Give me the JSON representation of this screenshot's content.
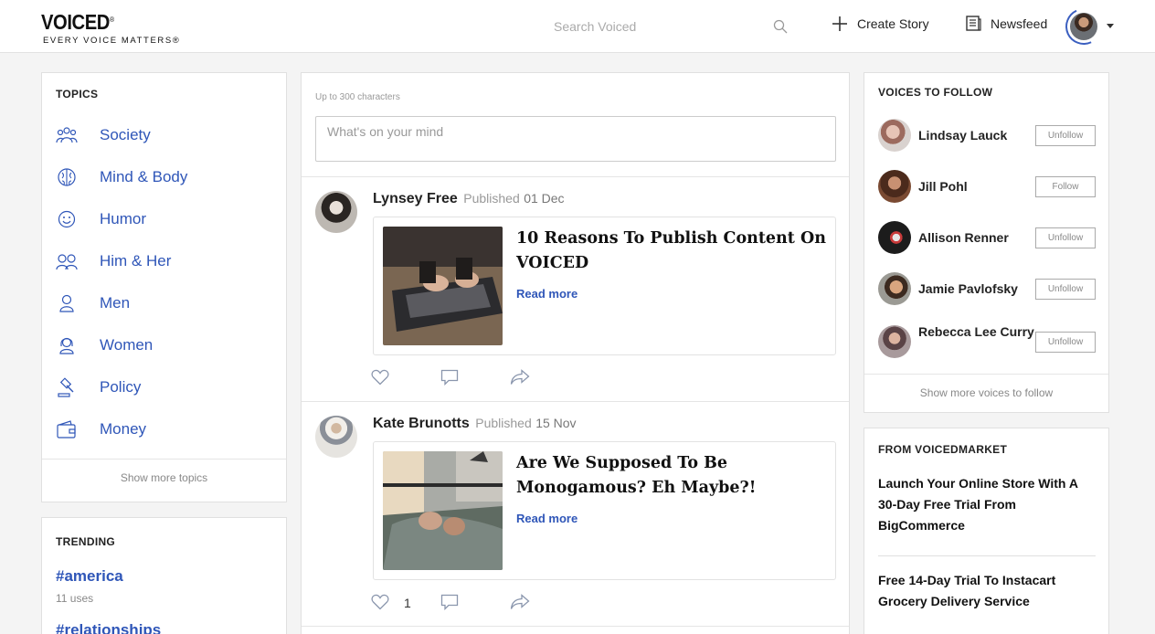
{
  "colors": {
    "accent": "#2f56b8",
    "background": "#f4f4f4"
  },
  "header": {
    "logo": "VOICED",
    "logo_mark": "®",
    "tagline": "EVERY VOICE MATTERS®",
    "search_placeholder": "Search Voiced",
    "create_label": "Create Story",
    "newsfeed_label": "Newsfeed"
  },
  "topics": {
    "title": "TOPICS",
    "items": [
      {
        "label": "Society",
        "icon": "people-group-icon"
      },
      {
        "label": "Mind & Body",
        "icon": "brain-icon"
      },
      {
        "label": "Humor",
        "icon": "smile-icon"
      },
      {
        "label": "Him & Her",
        "icon": "couple-icon"
      },
      {
        "label": "Men",
        "icon": "man-icon"
      },
      {
        "label": "Women",
        "icon": "woman-icon"
      },
      {
        "label": "Policy",
        "icon": "gavel-icon"
      },
      {
        "label": "Money",
        "icon": "wallet-icon"
      }
    ],
    "footer": "Show more topics"
  },
  "trending": {
    "title": "TRENDING",
    "items": [
      {
        "tag": "#america",
        "uses": "11 uses"
      },
      {
        "tag": "#relationships"
      }
    ]
  },
  "feed": {
    "compose_hint": "Up to 300 characters",
    "compose_placeholder": "What's on your mind",
    "posts": [
      {
        "author": "Lynsey Free",
        "published_label": "Published",
        "date": "01 Dec",
        "title": "10 Reasons To Publish Content On VOICED",
        "read_more": "Read more",
        "likes": ""
      },
      {
        "author": "Kate Brunotts",
        "published_label": "Published",
        "date": "15 Nov",
        "title": "Are We Supposed To Be Monogamous? Eh Maybe?!",
        "read_more": "Read more",
        "likes": "1"
      }
    ]
  },
  "voices": {
    "title": "VOICES TO FOLLOW",
    "items": [
      {
        "name": "Lindsay Lauck",
        "button": "Unfollow"
      },
      {
        "name": "Jill Pohl",
        "button": "Follow"
      },
      {
        "name": "Allison Renner",
        "button": "Unfollow"
      },
      {
        "name": "Jamie Pavlofsky",
        "button": "Unfollow"
      },
      {
        "name": "Rebecca Lee Curry",
        "button": "Unfollow"
      }
    ],
    "footer": "Show more voices to follow"
  },
  "market": {
    "title": "FROM VOICEDMARKET",
    "offers": [
      "Launch Your Online Store With A 30-Day Free Trial From BigCommerce",
      "Free 14-Day Trial To Instacart Grocery Delivery Service"
    ]
  }
}
